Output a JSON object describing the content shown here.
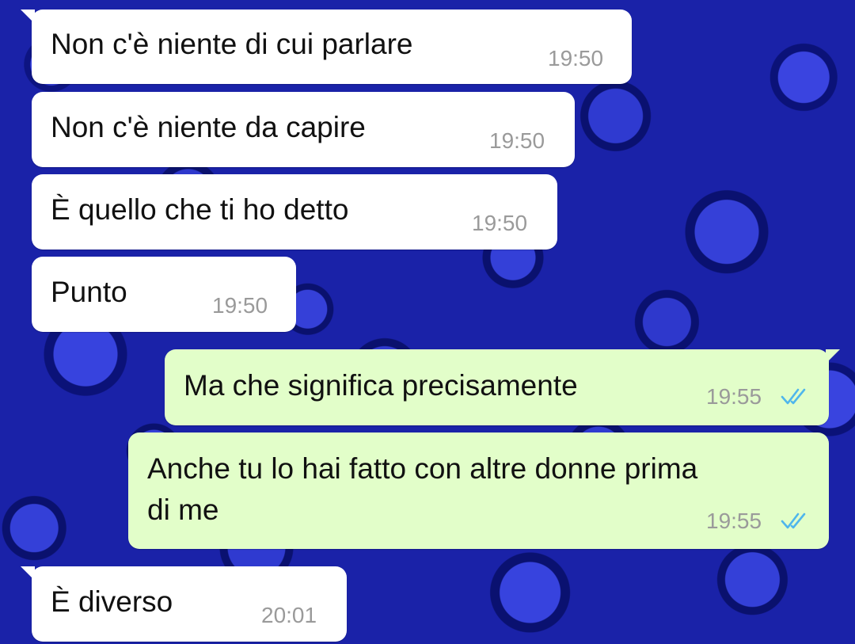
{
  "chat": {
    "accent_tick_color": "#4fb6ec",
    "messages": [
      {
        "direction": "in",
        "text": "Non c'è niente di cui parlare",
        "time": "19:50"
      },
      {
        "direction": "in",
        "text": "Non c'è niente da capire",
        "time": "19:50"
      },
      {
        "direction": "in",
        "text": "È quello che ti ho detto",
        "time": "19:50"
      },
      {
        "direction": "in",
        "text": "Punto",
        "time": "19:50"
      },
      {
        "direction": "out",
        "text": "Ma che significa precisamente",
        "time": "19:55",
        "status": "read-double-check-icon"
      },
      {
        "direction": "out",
        "text_line1": "Anche tu lo hai fatto con altre donne prima",
        "text_line2": "di me",
        "time": "19:55",
        "status": "read-double-check-icon"
      },
      {
        "direction": "in",
        "text": "È diverso",
        "time": "20:01"
      }
    ]
  }
}
